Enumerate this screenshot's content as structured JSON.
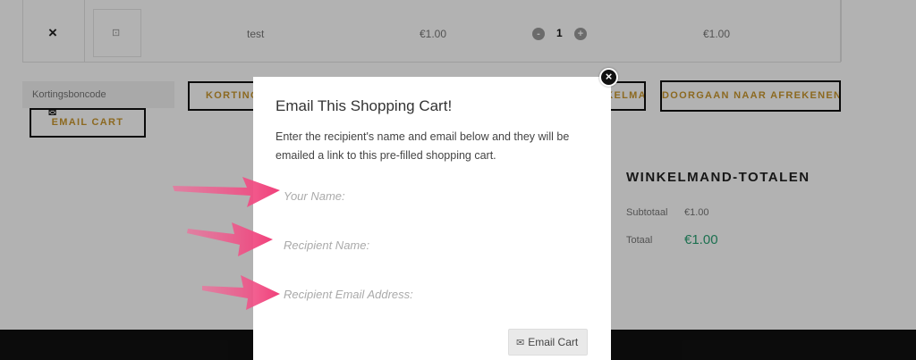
{
  "cart": {
    "remove_glyph": "×",
    "product_name": "test",
    "price": "€1.00",
    "quantity": "1",
    "qty_minus": "-",
    "qty_plus": "+",
    "line_total": "€1.00"
  },
  "coupon": {
    "placeholder": "Kortingsboncode",
    "apply_label": "KORTINGSBON TOEPASSEN",
    "update_label": "WINKELMAND BIJWERKEN",
    "email_cart_label": "EMAIL CART",
    "checkout_label": "DOORGAAN NAAR AFREKENEN"
  },
  "totals": {
    "title": "WINKELMAND-TOTALEN",
    "subtotal_label": "Subtotaal",
    "subtotal_value": "€1.00",
    "total_label": "Totaal",
    "total_value": "€1.00"
  },
  "modal": {
    "title": "Email This Shopping Cart!",
    "description": "Enter the recipient's name and email below and they will be emailed a link to this pre-filled shopping cart.",
    "your_name_placeholder": "Your Name:",
    "recipient_name_placeholder": "Recipient Name:",
    "recipient_email_placeholder": "Recipient Email Address:",
    "submit_label": "Email Cart",
    "close_glyph": "×"
  },
  "icons": {
    "envelope": "envelope-icon",
    "close": "close-icon",
    "arrow": "arrow-annotation-icon"
  },
  "colors": {
    "accent_gold": "#c9972f",
    "total_green": "#2aa173",
    "arrow_pink": "#f0407a"
  }
}
